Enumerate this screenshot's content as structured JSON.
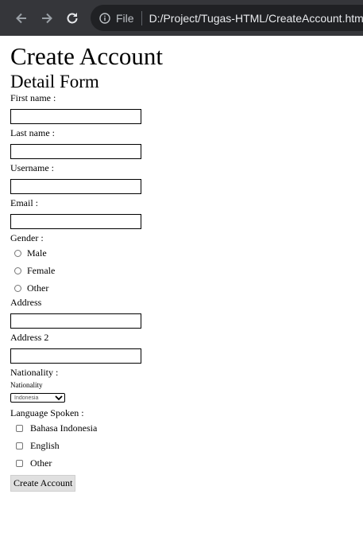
{
  "browser": {
    "file_label": "File",
    "url": "D:/Project/Tugas-HTML/CreateAccount.html"
  },
  "page": {
    "title": "Create Account",
    "subtitle": "Detail Form"
  },
  "form": {
    "first_name_label": "First name :",
    "last_name_label": "Last name :",
    "username_label": "Username :",
    "email_label": "Email :",
    "gender_label": "Gender :",
    "gender_options": [
      "Male",
      "Female",
      "Other"
    ],
    "address_label": "Address",
    "address2_label": "Address 2",
    "nationality_label": "Nationality :",
    "nationality_small_label": "Nationality",
    "nationality_selected": "Indonesia",
    "language_label": "Language Spoken :",
    "language_options": [
      "Bahasa Indonesia",
      "English",
      "Other"
    ],
    "submit_label": "Create Account"
  },
  "colors": {
    "chrome_bg": "#35363a",
    "omnibox_bg": "#202124",
    "button_bg": "#e0e0e0"
  }
}
